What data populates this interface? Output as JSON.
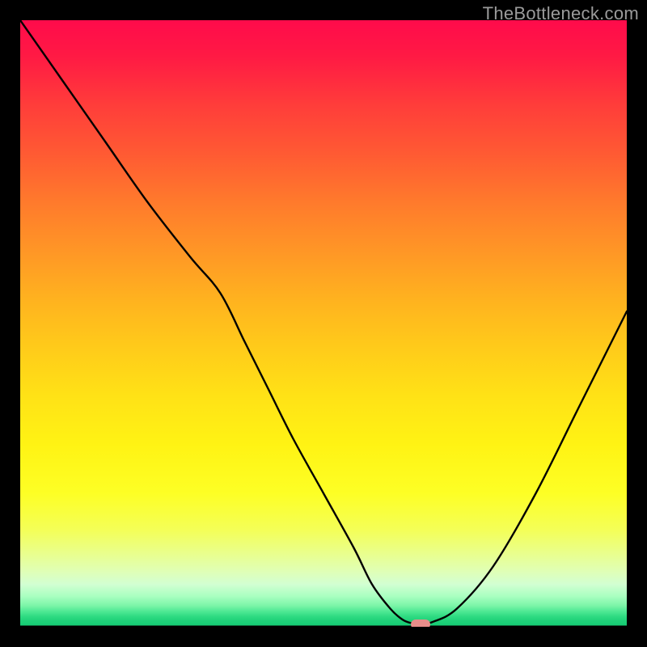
{
  "watermark": "TheBottleneck.com",
  "chart_data": {
    "type": "line",
    "title": "",
    "xlabel": "",
    "ylabel": "",
    "xlim": [
      0,
      100
    ],
    "ylim": [
      0,
      100
    ],
    "grid": false,
    "legend": false,
    "background": "vertical-gradient-red-to-green",
    "curve": {
      "name": "bottleneck-metric",
      "x": [
        0,
        7,
        14,
        21,
        28,
        33,
        37,
        41,
        45,
        50,
        55,
        58,
        61,
        63,
        64.5,
        66,
        68,
        72,
        78,
        85,
        92,
        100
      ],
      "y": [
        100,
        90,
        80,
        70,
        61,
        55,
        47,
        39,
        31,
        22,
        13,
        7,
        3,
        1.2,
        0.6,
        0.5,
        0.8,
        3,
        10,
        22,
        36,
        52
      ],
      "notes": "Represents a V-shaped performance/bottleneck curve. Values are read off the image by position, approximate."
    },
    "marker": {
      "name": "optimal-point",
      "x": 66,
      "y": 0.4,
      "shape": "rounded-rect",
      "color": "#e88d8a"
    },
    "color_scale_meaning": {
      "top": "worst (red)",
      "bottom": "best (green)"
    }
  }
}
